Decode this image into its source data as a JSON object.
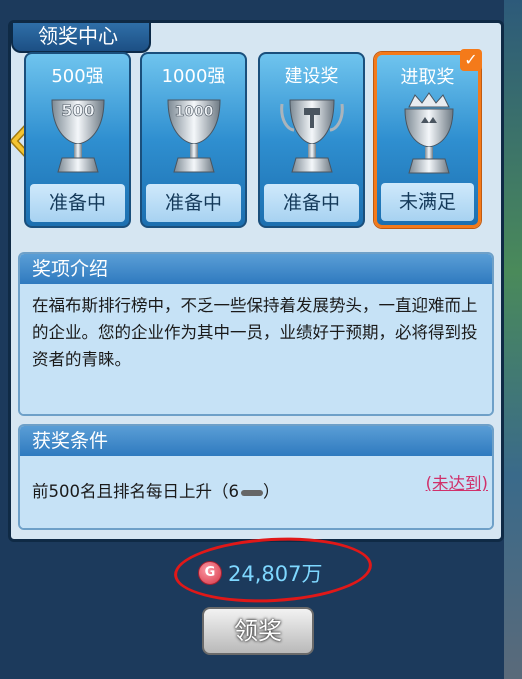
{
  "panel": {
    "title": "领奖中心"
  },
  "cards": [
    {
      "title": "500强",
      "status": "准备中",
      "trophy": "trophy-500-icon"
    },
    {
      "title": "1000强",
      "status": "准备中",
      "trophy": "trophy-1000-icon"
    },
    {
      "title": "建设奖",
      "status": "准备中",
      "trophy": "trophy-hammer-icon"
    },
    {
      "title": "进取奖",
      "status": "未满足",
      "trophy": "trophy-crown-icon",
      "active": true
    }
  ],
  "intro": {
    "heading": "奖项介绍",
    "text": "在福布斯排行榜中，不乏一些保持着发展势头，一直迎难而上的企业。您的企业作为其中一员，业绩好于预期，必将得到投资者的青睐。"
  },
  "conditions": {
    "heading": "获奖条件",
    "text": "前500名且排名每日上升（6",
    "text_end": "）",
    "status": "(未达到)"
  },
  "reward": {
    "amount": "24,807万",
    "icon": "coin-icon"
  },
  "claim_button": "领奖",
  "colors": {
    "accent": "#f47a1a",
    "status_red": "#d0306a",
    "reward": "#7fd8ff"
  }
}
